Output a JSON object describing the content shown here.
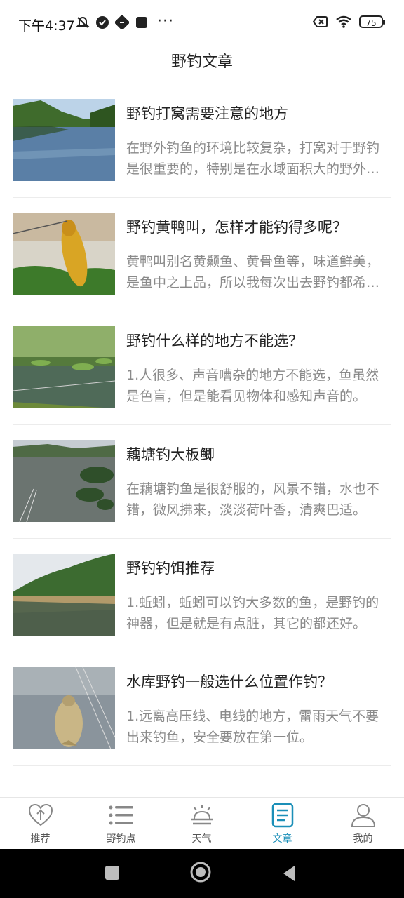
{
  "status_bar": {
    "time": "下午4:37",
    "dots": "···",
    "battery": "75"
  },
  "header": {
    "title": "野钓文章"
  },
  "articles": [
    {
      "title": "野钓打窝需要注意的地方",
      "summary": "在野外钓鱼的环境比较复杂，打窝对于野钓是很重要的，特别是在水域面积大的野外水域，打窝是很重要的。"
    },
    {
      "title": "野钓黄鸭叫，怎样才能钓得多呢？",
      "summary": "黄鸭叫别名黄颡鱼、黄骨鱼等，味道鲜美，是鱼中之上品，所以我每次出去野钓都希望能钓到它。"
    },
    {
      "title": "野钓什么样的地方不能选？",
      "summary": "1.人很多、声音嘈杂的地方不能选，鱼虽然是色盲，但是能看见物体和感知声音的。"
    },
    {
      "title": "藕塘钓大板鲫",
      "summary": "在藕塘钓鱼是很舒服的，风景不错，水也不错，微风拂来，淡淡荷叶香，清爽巴适。"
    },
    {
      "title": "野钓钓饵推荐",
      "summary": "1.蚯蚓，蚯蚓可以钓大多数的鱼，是野钓的神器，但是就是有点脏，其它的都还好。"
    },
    {
      "title": "水库野钓一般选什么位置作钓？",
      "summary": "1.远离高压线、电线的地方，雷雨天气不要出来钓鱼，安全要放在第一位。"
    }
  ],
  "tabs": [
    {
      "label": "推荐",
      "icon": "heart-arrow-icon"
    },
    {
      "label": "野钓点",
      "icon": "list-icon"
    },
    {
      "label": "天气",
      "icon": "weather-icon"
    },
    {
      "label": "文章",
      "icon": "article-icon",
      "active": true
    },
    {
      "label": "我的",
      "icon": "user-icon"
    }
  ],
  "colors": {
    "accent": "#1b8fb8",
    "text": "#222222",
    "summary": "#8a8a8a"
  }
}
